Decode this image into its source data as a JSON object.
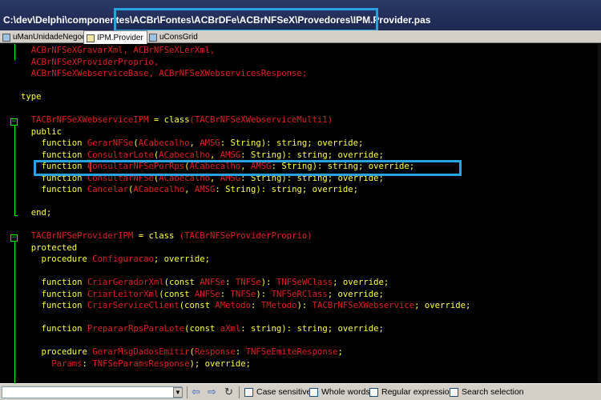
{
  "window": {
    "title_path": "C:\\dev\\Delphi\\componentes\\ACBr\\Fontes\\ACBrDFe\\ACBrNFSeX\\Provedores\\IPM.Provider.pas"
  },
  "tabs": [
    {
      "label": "uManUnidadeNegocio",
      "active": false
    },
    {
      "label": "IPM.Provider",
      "active": true
    },
    {
      "label": "uConsGrid",
      "active": false
    }
  ],
  "code_lines": [
    [
      {
        "t": "  ACBrNFSeXGravarXml, ACBrNFSeXLerXml,",
        "c": "r"
      }
    ],
    [
      {
        "t": "  ACBrNFSeXProviderProprio,",
        "c": "r"
      }
    ],
    [
      {
        "t": "  ACBrNFSeXWebserviceBase, ACBrNFSeXWebservicesResponse;",
        "c": "r"
      }
    ],
    [],
    [
      {
        "t": "type",
        "c": "y"
      }
    ],
    [],
    [
      {
        "t": "  TACBrNFSeXWebserviceIPM",
        "c": "r"
      },
      {
        "t": " = ",
        "c": "y"
      },
      {
        "t": "class",
        "c": "y"
      },
      {
        "t": "(TACBrNFSeXWebserviceMulti1)",
        "c": "r"
      }
    ],
    [
      {
        "t": "  public",
        "c": "y"
      }
    ],
    [
      {
        "t": "    function ",
        "c": "y"
      },
      {
        "t": "GerarNFSe",
        "c": "r"
      },
      {
        "t": "(",
        "c": "y"
      },
      {
        "t": "ACabecalho",
        "c": "r"
      },
      {
        "t": ", ",
        "c": "y"
      },
      {
        "t": "AMSG",
        "c": "r"
      },
      {
        "t": ": String): string; override;",
        "c": "y"
      }
    ],
    [
      {
        "t": "    function ",
        "c": "y"
      },
      {
        "t": "ConsultarLote",
        "c": "r"
      },
      {
        "t": "(",
        "c": "y"
      },
      {
        "t": "ACabecalho",
        "c": "r"
      },
      {
        "t": ", ",
        "c": "y"
      },
      {
        "t": "AMSG",
        "c": "r"
      },
      {
        "t": ": String): string; override;",
        "c": "y"
      }
    ],
    [
      {
        "t": "    function ",
        "c": "y"
      },
      {
        "t": "ConsultarNFSePorRps",
        "c": "r"
      },
      {
        "t": "(",
        "c": "y"
      },
      {
        "t": "ACabecalho",
        "c": "r"
      },
      {
        "t": ", ",
        "c": "y"
      },
      {
        "t": "AMSG",
        "c": "r"
      },
      {
        "t": ": String): string; override;",
        "c": "y"
      }
    ],
    [
      {
        "t": "    function ",
        "c": "y"
      },
      {
        "t": "ConsultarNFSe",
        "c": "r"
      },
      {
        "t": "(",
        "c": "y"
      },
      {
        "t": "ACabecalho",
        "c": "r"
      },
      {
        "t": ", ",
        "c": "y"
      },
      {
        "t": "AMSG",
        "c": "r"
      },
      {
        "t": ": String): string; override;",
        "c": "y"
      }
    ],
    [
      {
        "t": "    function ",
        "c": "y"
      },
      {
        "t": "Cancelar",
        "c": "r"
      },
      {
        "t": "(",
        "c": "y"
      },
      {
        "t": "ACabecalho",
        "c": "r"
      },
      {
        "t": ", ",
        "c": "y"
      },
      {
        "t": "AMSG",
        "c": "r"
      },
      {
        "t": ": String): string; override;",
        "c": "y"
      }
    ],
    [],
    [
      {
        "t": "  end;",
        "c": "y"
      }
    ],
    [],
    [
      {
        "t": "  TACBrNFSeProviderIPM",
        "c": "r"
      },
      {
        "t": " = ",
        "c": "y"
      },
      {
        "t": "class ",
        "c": "y"
      },
      {
        "t": "(TACBrNFSeProviderProprio)",
        "c": "r"
      }
    ],
    [
      {
        "t": "  protected",
        "c": "y"
      }
    ],
    [
      {
        "t": "    procedure ",
        "c": "y"
      },
      {
        "t": "Configuracao",
        "c": "r"
      },
      {
        "t": "; override;",
        "c": "y"
      }
    ],
    [],
    [
      {
        "t": "    function ",
        "c": "y"
      },
      {
        "t": "CriarGeradorXml",
        "c": "r"
      },
      {
        "t": "(const ",
        "c": "y"
      },
      {
        "t": "ANFSe",
        "c": "r"
      },
      {
        "t": ": ",
        "c": "y"
      },
      {
        "t": "TNFSe",
        "c": "r"
      },
      {
        "t": "): ",
        "c": "y"
      },
      {
        "t": "TNFSeWClass",
        "c": "r"
      },
      {
        "t": "; override;",
        "c": "y"
      }
    ],
    [
      {
        "t": "    function ",
        "c": "y"
      },
      {
        "t": "CriarLeitorXml",
        "c": "r"
      },
      {
        "t": "(const ",
        "c": "y"
      },
      {
        "t": "ANFSe",
        "c": "r"
      },
      {
        "t": ": ",
        "c": "y"
      },
      {
        "t": "TNFSe",
        "c": "r"
      },
      {
        "t": "): ",
        "c": "y"
      },
      {
        "t": "TNFSeRClass",
        "c": "r"
      },
      {
        "t": "; override;",
        "c": "y"
      }
    ],
    [
      {
        "t": "    function ",
        "c": "y"
      },
      {
        "t": "CriarServiceClient",
        "c": "r"
      },
      {
        "t": "(const ",
        "c": "y"
      },
      {
        "t": "AMetodo",
        "c": "r"
      },
      {
        "t": ": ",
        "c": "y"
      },
      {
        "t": "TMetodo",
        "c": "r"
      },
      {
        "t": "): ",
        "c": "y"
      },
      {
        "t": "TACBrNFSeXWebservice",
        "c": "r"
      },
      {
        "t": "; override;",
        "c": "y"
      }
    ],
    [],
    [
      {
        "t": "    function ",
        "c": "y"
      },
      {
        "t": "PrepararRpsParaLote",
        "c": "r"
      },
      {
        "t": "(const ",
        "c": "y"
      },
      {
        "t": "aXml",
        "c": "r"
      },
      {
        "t": ": string): string; override;",
        "c": "y"
      }
    ],
    [],
    [
      {
        "t": "    procedure ",
        "c": "y"
      },
      {
        "t": "GerarMsgDadosEmitir",
        "c": "r"
      },
      {
        "t": "(",
        "c": "y"
      },
      {
        "t": "Response",
        "c": "r"
      },
      {
        "t": ": ",
        "c": "y"
      },
      {
        "t": "TNFSeEmiteResponse",
        "c": "r"
      },
      {
        "t": ";",
        "c": "y"
      }
    ],
    [
      {
        "t": "      Params",
        "c": "r"
      },
      {
        "t": ": ",
        "c": "y"
      },
      {
        "t": "TNFSeParamsResponse",
        "c": "r"
      },
      {
        "t": "); override;",
        "c": "y"
      }
    ]
  ],
  "search": {
    "value": "",
    "case_sensitive_label": "Case sensitive",
    "whole_words_label": "Whole words",
    "regex_label": "Regular expression",
    "search_selection_label": "Search selection"
  }
}
